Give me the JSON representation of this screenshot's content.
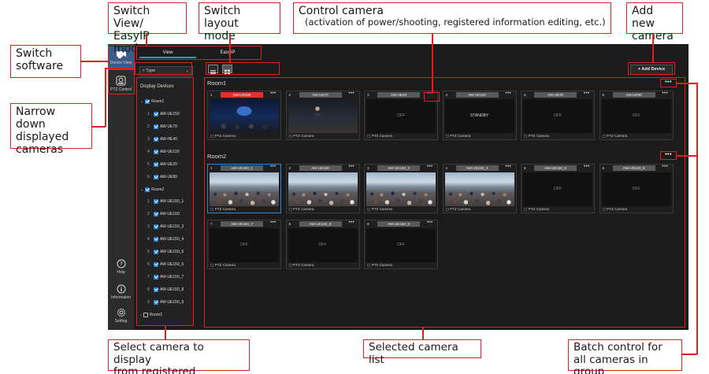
{
  "annotations": {
    "switch_view": "Switch View/\nEasyIP mode",
    "switch_layout": "Switch layout\nmode",
    "control_camera_title": "Control camera",
    "control_camera_sub": "(activation of power/shooting, registered information editing, etc.)",
    "add_camera": "Add new\ncamera",
    "switch_software": "Switch\nsoftware",
    "narrow_down": "Narrow down\ndisplayed\ncameras",
    "select_camera": "Select camera to display\nfrom registered cameras",
    "selected_list": "Selected camera list",
    "batch_control": "Batch control for\nall cameras in group"
  },
  "rail": {
    "device_view": "Device View",
    "ptz_control": "PTZ Control",
    "help": "Help",
    "information": "Information",
    "setting": "Setting"
  },
  "mode_tabs": {
    "view": "View",
    "easyip": "EasyIP"
  },
  "filter": {
    "label": "Type"
  },
  "sidebar": {
    "title": "Display Devices",
    "room1": "Room1",
    "room1_items": [
      "AW-UE150",
      "AW-UE70",
      "AW-HE40",
      "AW-UE100",
      "AW-UE20",
      "AW-UE80"
    ],
    "room2": "Room2",
    "room2_items": [
      "AW-UE150_1",
      "AW-UE160",
      "AW-UE150_3",
      "AW-UE150_4",
      "AW-UE150_5",
      "AW-UE150_6",
      "AW-UE150_7",
      "AW-UE150_8",
      "AW-UE150_9"
    ],
    "room3": "Room3"
  },
  "toolbar": {
    "add_device": "+ Add Device"
  },
  "groups": {
    "room1": {
      "title": "Room1",
      "cards": [
        {
          "idx": "1",
          "name": "AW-UE150",
          "status": "",
          "foot": "PTZ Camera"
        },
        {
          "idx": "2",
          "name": "AW-UE70",
          "status": "",
          "foot": "PTZ Camera"
        },
        {
          "idx": "3",
          "name": "AW-HE40",
          "status": "OFF",
          "foot": "PTZ Camera"
        },
        {
          "idx": "4",
          "name": "AW-UE100",
          "status": "STANDBY",
          "foot": "PTZ Camera"
        },
        {
          "idx": "5",
          "name": "AW-UE20",
          "status": "OFF",
          "foot": "PTZ Camera"
        },
        {
          "idx": "6",
          "name": "AW-UE80",
          "status": "OFF",
          "foot": "PTZ Camera"
        }
      ]
    },
    "room2": {
      "title": "Room2",
      "cards": [
        {
          "idx": "1",
          "name": "AW-UE150_1",
          "status": "",
          "foot": "PTZ Camera"
        },
        {
          "idx": "2",
          "name": "AW-UE160",
          "status": "",
          "foot": "PTZ Camera"
        },
        {
          "idx": "3",
          "name": "AW-UE150_3",
          "status": "",
          "foot": "PTZ Camera"
        },
        {
          "idx": "4",
          "name": "AW-UE150_4",
          "status": "",
          "foot": "PTZ Camera"
        },
        {
          "idx": "5",
          "name": "AW-UE150_5",
          "status": "OFF",
          "foot": "PTZ Camera"
        },
        {
          "idx": "6",
          "name": "AW-UE150_6",
          "status": "OFF",
          "foot": "PTZ Camera"
        },
        {
          "idx": "7",
          "name": "AW-UE150_7",
          "status": "OFF",
          "foot": "PTZ Camera"
        },
        {
          "idx": "8",
          "name": "AW-UE150_8",
          "status": "OFF",
          "foot": "PTZ Camera"
        },
        {
          "idx": "9",
          "name": "AW-UE150_9",
          "status": "OFF",
          "foot": "PTZ Camera"
        }
      ]
    }
  },
  "colors": {
    "annotation": "#e02020",
    "accent": "#2f86d8",
    "rec": "#e03030"
  }
}
